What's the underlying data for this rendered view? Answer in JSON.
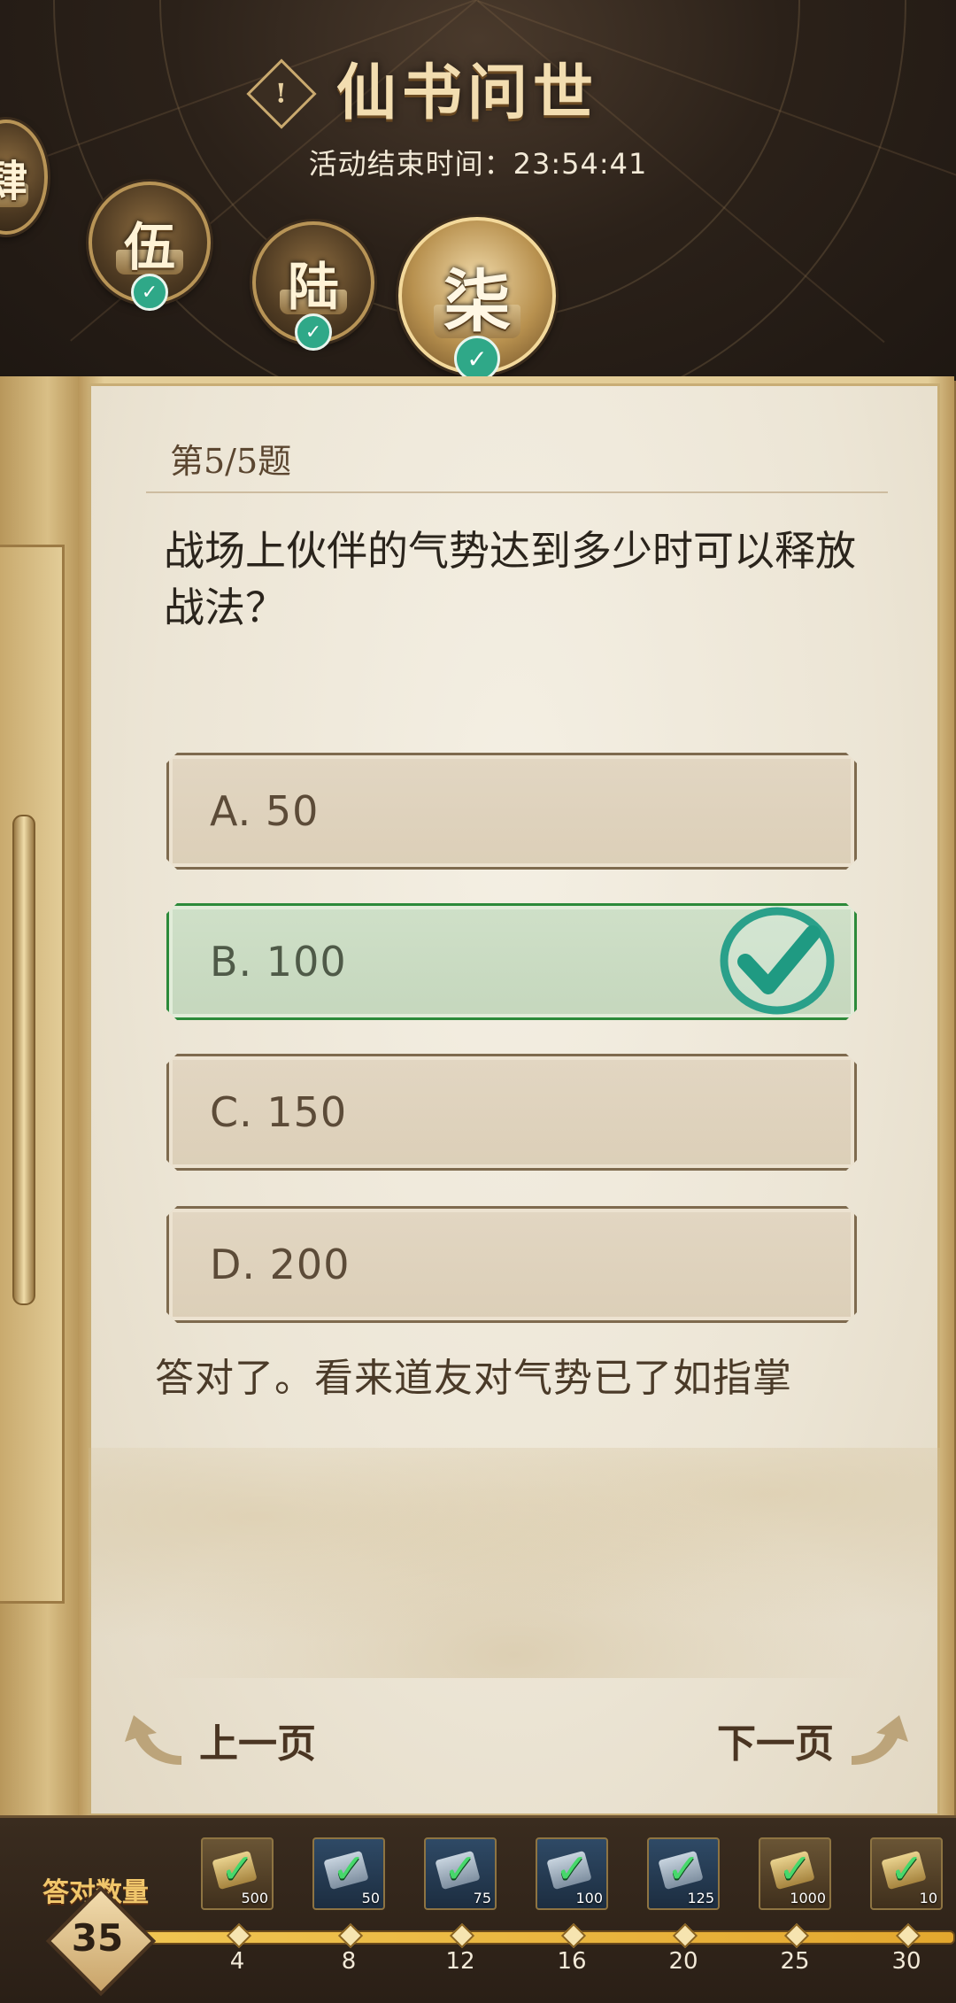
{
  "header": {
    "title": "仙书问世",
    "end_time_label": "活动结束时间：",
    "end_time_value": "23:54:41",
    "info_icon": "!",
    "chapters": [
      {
        "glyph": "肆",
        "completed": true
      },
      {
        "glyph": "伍",
        "completed": true
      },
      {
        "glyph": "陆",
        "completed": true
      },
      {
        "glyph": "柒",
        "completed": true,
        "selected": true
      }
    ]
  },
  "quiz": {
    "question_index": "第5/5题",
    "question": "战场上伙伴的气势达到多少时可以释放战法？",
    "options": [
      {
        "label": "A. 50",
        "state": "normal"
      },
      {
        "label": "B. 100",
        "state": "correct"
      },
      {
        "label": "C. 150",
        "state": "normal"
      },
      {
        "label": "D. 200",
        "state": "normal"
      }
    ],
    "feedback": "答对了。看来道友对气势已了如指掌",
    "prev_label": "上一页",
    "next_label": "下一页"
  },
  "progress": {
    "label": "答对数量",
    "count": "35",
    "milestones": [
      "4",
      "8",
      "12",
      "16",
      "20",
      "25",
      "30"
    ],
    "rewards": [
      {
        "qty": "500",
        "style": "gold",
        "claimed": true
      },
      {
        "qty": "50",
        "style": "blue",
        "claimed": true
      },
      {
        "qty": "75",
        "style": "blue",
        "claimed": true
      },
      {
        "qty": "100",
        "style": "blue",
        "claimed": true
      },
      {
        "qty": "125",
        "style": "blue",
        "claimed": true
      },
      {
        "qty": "1000",
        "style": "gold",
        "claimed": true
      },
      {
        "qty": "10",
        "style": "gold",
        "claimed": true
      }
    ]
  },
  "colors": {
    "correct_green": "#2c8a3a",
    "check_teal": "#2fa888",
    "gold_accent": "#f0c66b"
  }
}
